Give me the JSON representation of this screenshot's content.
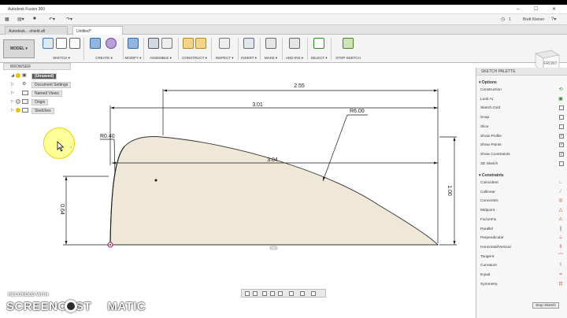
{
  "window": {
    "title": "Autodesk Fusion 360",
    "user": "Brett Kleiser",
    "notifications": "1"
  },
  "tabs": [
    {
      "label": "Autodesk... shield.afl"
    },
    {
      "label": "Untitled*"
    }
  ],
  "ribbon": {
    "workspace": "MODEL ▾",
    "groups": [
      {
        "label": "SKETCH ▾"
      },
      {
        "label": "CREATE ▾"
      },
      {
        "label": "MODIFY ▾"
      },
      {
        "label": "ASSEMBLE ▾"
      },
      {
        "label": "CONSTRUCT ▾"
      },
      {
        "label": "INSPECT ▾"
      },
      {
        "label": "INSERT ▾"
      },
      {
        "label": "MAKE ▾"
      },
      {
        "label": "ADD-INS ▾"
      },
      {
        "label": "SELECT ▾"
      },
      {
        "label": "STOP SKETCH"
      }
    ]
  },
  "browser": {
    "title": "BROWSER",
    "items": [
      {
        "label": "(Unsaved)"
      },
      {
        "label": "Document Settings"
      },
      {
        "label": "Named Views"
      },
      {
        "label": "Origin"
      },
      {
        "label": "Sketches"
      }
    ]
  },
  "sketch": {
    "dims": {
      "d255": "2.55",
      "d301": "3.01",
      "d304": "3.04",
      "r600": "R6.00",
      "r040": "R0.40",
      "d100": "1.00",
      "d064": "0.64"
    }
  },
  "viewcube": {
    "label": "FRONT"
  },
  "palette": {
    "title": "SKETCH PALETTE",
    "options_title": "Options",
    "options": [
      {
        "label": "Construction",
        "icon": "construction-icon"
      },
      {
        "label": "Look At",
        "icon": "look-at-icon"
      },
      {
        "label": "Sketch Grid",
        "checked": false
      },
      {
        "label": "Snap",
        "checked": false
      },
      {
        "label": "Slice",
        "checked": false
      },
      {
        "label": "Show Profile",
        "checked": true
      },
      {
        "label": "Show Points",
        "checked": true
      },
      {
        "label": "Show Constraints",
        "checked": true
      },
      {
        "label": "3D Sketch",
        "checked": false
      }
    ],
    "constraints_title": "Constraints",
    "constraints": [
      {
        "label": "Coincident",
        "glyph": "∟",
        "color": "#777777"
      },
      {
        "label": "Collinear",
        "glyph": "⁄",
        "color": "#777777"
      },
      {
        "label": "Concentric",
        "glyph": "◎",
        "color": "#d23b2b"
      },
      {
        "label": "Midpoint",
        "glyph": "△",
        "color": "#d23b2b"
      },
      {
        "label": "Fix/UnFix",
        "glyph": "⚠",
        "color": "#d23b2b"
      },
      {
        "label": "Parallel",
        "glyph": "∥",
        "color": "#777777"
      },
      {
        "label": "Perpendicular",
        "glyph": "⊥",
        "color": "#d23b2b"
      },
      {
        "label": "Horizontal/Vertical",
        "glyph": "‖",
        "color": "#d23b2b"
      },
      {
        "label": "Tangent",
        "glyph": "⌒",
        "color": "#d23b2b"
      },
      {
        "label": "Curvature",
        "glyph": "⌇",
        "color": "#d23b2b"
      },
      {
        "label": "Equal",
        "glyph": "=",
        "color": "#d23b2b"
      },
      {
        "label": "Symmetry",
        "glyph": "⊡",
        "color": "#d23b2b"
      }
    ],
    "stop_label": "Stop Sketch"
  },
  "watermark": {
    "line1": "RECORDED WITH",
    "line2a": "SCREENCAST",
    "line2b": "MATIC"
  },
  "colors": {
    "profile_fill": "#efe7d8",
    "dim_color": "#1a1a1a",
    "accent": "#3a78c2"
  }
}
